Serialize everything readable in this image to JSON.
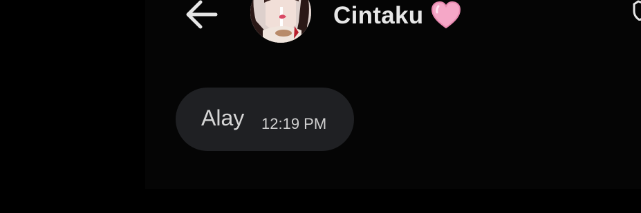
{
  "header": {
    "back_icon": "arrow-left-icon",
    "contact_name": "Cintaku",
    "name_emoji_icon": "pink-heart-icon",
    "right_icon": "shield-icon"
  },
  "message": {
    "text": "Alay",
    "time": "12:19 PM"
  },
  "colors": {
    "background": "#000000",
    "panel": "#050505",
    "bubble": "#1f2023",
    "text": "#e7e7e7",
    "heart": "#f5a7c7"
  }
}
